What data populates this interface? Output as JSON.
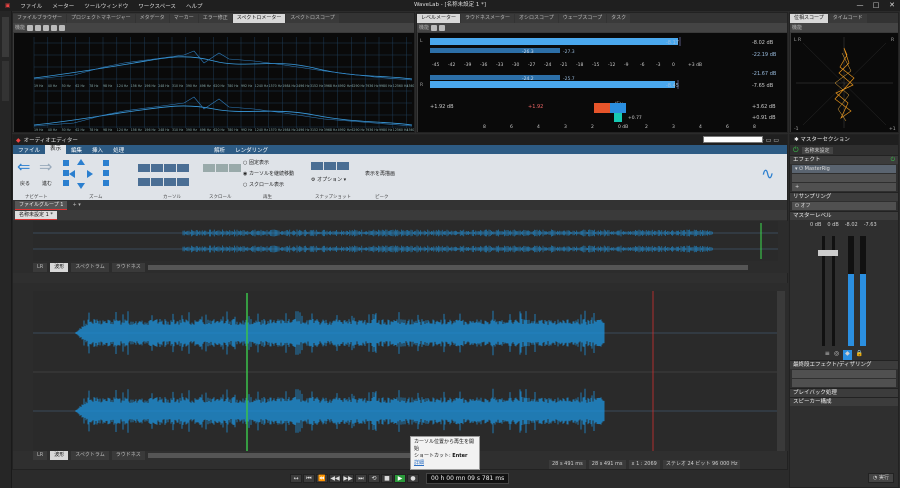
{
  "window": {
    "title": "WaveLab - [名称未設定 1 *]",
    "menu": [
      "ファイル",
      "メーター",
      "ツールウィンドウ",
      "ワークスペース",
      "ヘルプ"
    ],
    "controls": [
      "—",
      "□",
      "✕"
    ]
  },
  "meter_tabs": [
    "ファイルブラウザー",
    "プロジェクトマネージャー",
    "メタデータ",
    "マーカー",
    "エラー修正",
    "スペクトロメーター",
    "スペクトロスコープ"
  ],
  "meter_tabs_active": "スペクトロメーター",
  "spectro": {
    "func_label": "機能",
    "freq_ticks": [
      "19 Hz",
      "40 Hz",
      "50 Hz",
      "62 Hz",
      "78 Hz",
      "98 Hz",
      "124 Hz",
      "156 Hz",
      "196 Hz",
      "248 Hz",
      "310 Hz",
      "390 Hz",
      "496 Hz",
      "620 Hz",
      "780 Hz",
      "992 Hz",
      "1240 Hz",
      "1570 Hz",
      "1984 Hz",
      "2496 Hz",
      "3152 Hz",
      "3968 Hz",
      "4992 Hz",
      "6290 Hz",
      "7936 Hz",
      "9980 Hz",
      "12560 Hz",
      "15600 Hz"
    ]
  },
  "level_tabs": [
    "レベルメーター",
    "ラウドネスメーター",
    "オシロスコープ",
    "ウェーブスコープ",
    "タスク"
  ],
  "level": {
    "func_label": "機能",
    "values": {
      "peak_l": "-8.17",
      "peak_r": "-8.45",
      "max_l": "-8.02 dB",
      "max_r": "-7.65 dB",
      "rms_l": "-22.19 dB",
      "rms_r": "-21.67 dB",
      "rms_l_val": "-27.3",
      "rms_r_val": "-25.7",
      "inner_l": "-26.3",
      "inner_r": "-24.2"
    },
    "scale": [
      "-45",
      "-42",
      "-39",
      "-36",
      "-33",
      "-30",
      "-27",
      "-24",
      "-21",
      "-18",
      "-15",
      "-12",
      "-9",
      "-6",
      "-3",
      "0",
      "+3 dB"
    ],
    "pan_label": "パン",
    "pan_left": "+1.92 dB",
    "pan_mid": "+1.92",
    "pan_right_top": "+3.62 dB",
    "pan_right_bot": "+0.91 dB",
    "pan_val": "+0.77",
    "pan_scale": [
      "8",
      "6",
      "4",
      "3",
      "2",
      "0 dB",
      "2",
      "3",
      "4",
      "6",
      "8"
    ]
  },
  "phase_tabs": [
    "位相スコープ",
    "タイムコード"
  ],
  "phase": {
    "func_label": "機能",
    "corner_tl": "L R",
    "corner_tr": "R",
    "label_minus": "-1",
    "label_plus": "+1"
  },
  "audio_editor": {
    "title": "オーディオエディター",
    "ribbon_tabs": [
      "ファイル",
      "表示",
      "編集",
      "挿入",
      "処理",
      "解析",
      "レンダリング"
    ],
    "ribbon_active": "表示",
    "nav": {
      "back": "戻る",
      "forward": "進む"
    },
    "groups": [
      "ナビゲート",
      "ズーム",
      "カーソル",
      "スクロール",
      "再生",
      "スナップショット",
      "ピーク"
    ],
    "options": {
      "fixed": "固定表示",
      "follow": "カーソルを継続移動",
      "scroll": "スクロール表示"
    },
    "options_btn": "オプション",
    "redraw": "表示を再描画",
    "file_group": "ファイルグループ 1",
    "doc_tab": "名称未設定 1 *",
    "overview_tabs": [
      "LR",
      "波形",
      "スペクトラム",
      "ラウドネス"
    ],
    "main_tabs": [
      "LR",
      "波形",
      "スペクトラム",
      "ラウドネス"
    ],
    "status": {
      "sel1": "28 s 491 ms",
      "sel2": "28 s 491 ms",
      "zoom": "x 1 : 2069",
      "format": "ステレオ 24 ビット 96 000 Hz"
    }
  },
  "master": {
    "title": "マスターセクション",
    "preset": "名称未設定",
    "effects_label": "エフェクト",
    "plugin": "MasterRig",
    "resampling": "リサンプリング",
    "resample_val": "オフ",
    "level_label": "マスターレベル",
    "level_vals": [
      "0 dB",
      "0 dB",
      "-8.02",
      "-7.63"
    ],
    "final_fx": "最終段エフェクト/ディザリング",
    "playback": "プレイバック処理",
    "speaker": "スピーカー構成",
    "render": "実行"
  },
  "tooltip": {
    "line1": "カーソル位置から再生を開始",
    "line2_label": "ショートカット:",
    "line2_key": "Enter",
    "link": "詳細"
  },
  "transport": {
    "time": "00 h 00 mn 09 s 781 ms"
  },
  "colors": {
    "wave": "#1e8fd6",
    "accent_green": "#3ac24a",
    "ribbon_blue": "#2d5b84"
  }
}
